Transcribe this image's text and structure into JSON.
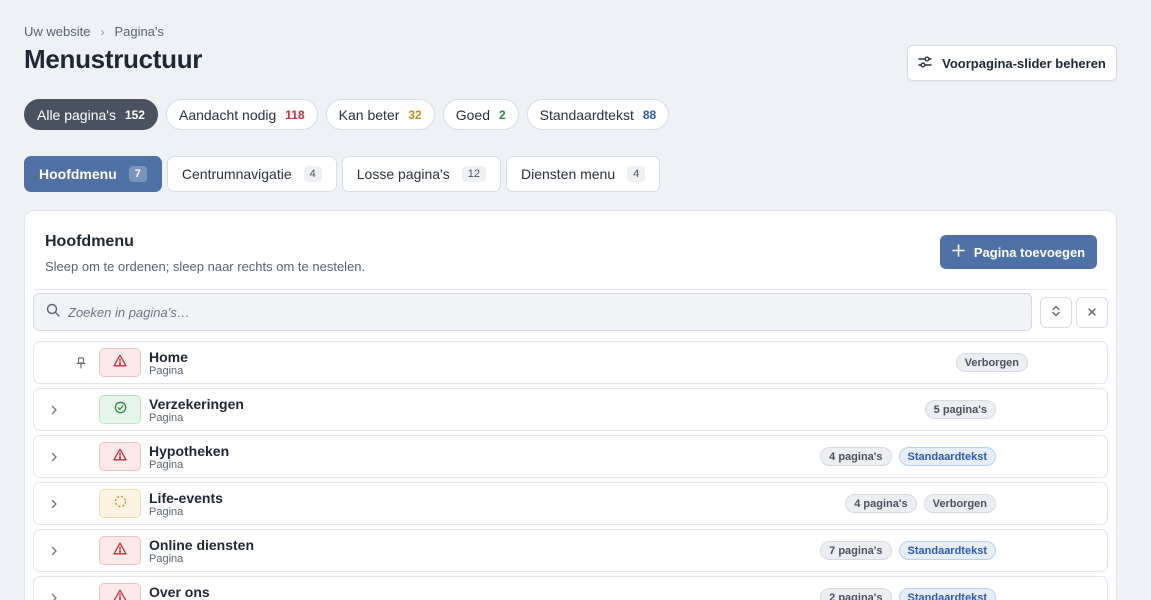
{
  "breadcrumb": {
    "items": [
      "Uw website",
      "Pagina's"
    ]
  },
  "page_title": "Menustructuur",
  "slider_button": "Voorpagina-slider beheren",
  "filters": [
    {
      "label": "Alle pagina's",
      "count": "152",
      "color": "#ffffff"
    },
    {
      "label": "Aandacht nodig",
      "count": "118",
      "color": "#c4313a"
    },
    {
      "label": "Kan beter",
      "count": "32",
      "color": "#c98a1a"
    },
    {
      "label": "Goed",
      "count": "2",
      "color": "#2c8a45"
    },
    {
      "label": "Standaardtekst",
      "count": "88",
      "color": "#2d5bb0"
    }
  ],
  "tabs": [
    {
      "label": "Hoofdmenu",
      "count": "7"
    },
    {
      "label": "Centrumnavigatie",
      "count": "4"
    },
    {
      "label": "Losse pagina's",
      "count": "12"
    },
    {
      "label": "Diensten menu",
      "count": "4"
    }
  ],
  "panel": {
    "title": "Hoofdmenu",
    "subtitle": "Sleep om te ordenen; sleep naar rechts om te nestelen.",
    "add_button": "Pagina toevoegen",
    "search_placeholder": "Zoeken in pagina's…"
  },
  "rows": [
    {
      "name": "Home",
      "type": "Pagina",
      "status": "warn",
      "chips": [
        "Verborgen"
      ]
    },
    {
      "name": "Verzekeringen",
      "type": "Pagina",
      "status": "ok",
      "chips": [
        "5 pagina's"
      ]
    },
    {
      "name": "Hypotheken",
      "type": "Pagina",
      "status": "warn",
      "chips": [
        "4 pagina's",
        "Standaardtekst"
      ]
    },
    {
      "name": "Life-events",
      "type": "Pagina",
      "status": "mid",
      "chips": [
        "4 pagina's",
        "Verborgen"
      ]
    },
    {
      "name": "Online diensten",
      "type": "Pagina",
      "status": "warn",
      "chips": [
        "7 pagina's",
        "Standaardtekst"
      ]
    },
    {
      "name": "Over ons",
      "type": "Pagina",
      "status": "warn",
      "chips": [
        "2 pagina's",
        "Standaardtekst"
      ]
    }
  ],
  "colors": {
    "accent": "#4f71a6",
    "active_filter": "#4a5260"
  },
  "icons": {
    "slider": "sliders-icon",
    "add": "plus-icon",
    "search": "search-icon",
    "expand": "expand-collapse-icon",
    "clear": "close-icon",
    "pin": "pin-icon",
    "chevron": "chevron-right-icon",
    "warning": "warning-triangle-icon",
    "check": "check-circle-icon",
    "pending": "dashed-circle-icon"
  }
}
